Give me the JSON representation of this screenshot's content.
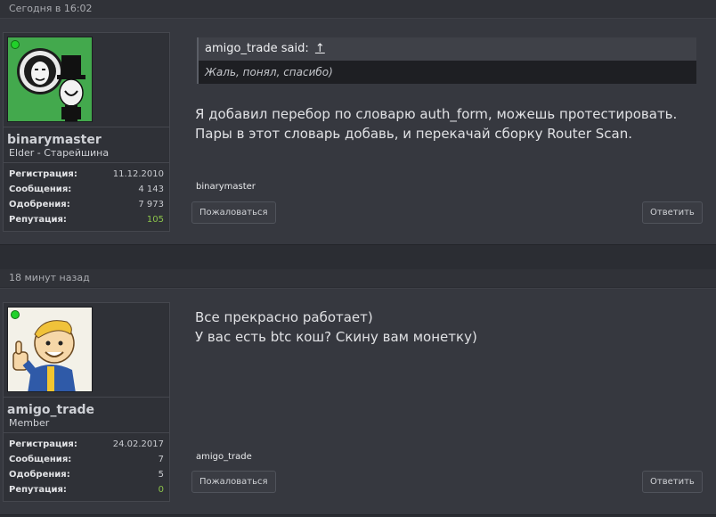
{
  "posts": [
    {
      "date": "Сегодня в 16:02",
      "user": {
        "name": "binarymaster",
        "title": "Elder - Старейшина",
        "stats": [
          {
            "label": "Регистрация:",
            "value": "11.12.2010"
          },
          {
            "label": "Сообщения:",
            "value": "4 143"
          },
          {
            "label": "Одобрения:",
            "value": "7 973"
          },
          {
            "label": "Репутация:",
            "value": "105"
          }
        ]
      },
      "quote": {
        "author": "amigo_trade said:",
        "arrow": "↑",
        "text": "Жаль, понял, спасибо)"
      },
      "message_lines": [
        "Я добавил перебор по словарю auth_form, можешь протестировать.",
        "Пары в этот словарь добавь, и перекачай сборку Router Scan."
      ],
      "signature": "binarymaster",
      "report_label": "Пожаловаться",
      "reply_label": "Ответить"
    },
    {
      "date": "18 минут назад",
      "user": {
        "name": "amigo_trade",
        "title": "Member",
        "stats": [
          {
            "label": "Регистрация:",
            "value": "24.02.2017"
          },
          {
            "label": "Сообщения:",
            "value": "7"
          },
          {
            "label": "Одобрения:",
            "value": "5"
          },
          {
            "label": "Репутация:",
            "value": "0"
          }
        ]
      },
      "message_lines": [
        "Все прекрасно работает)",
        "У вас есть btc кош? Скину вам монетку)"
      ],
      "signature": "amigo_trade",
      "report_label": "Пожаловаться",
      "reply_label": "Ответить"
    }
  ],
  "colors": {
    "online": "#21d12a",
    "reputation": "#8bc34a",
    "background": "#2b2d33",
    "post_bg": "#36383f"
  }
}
